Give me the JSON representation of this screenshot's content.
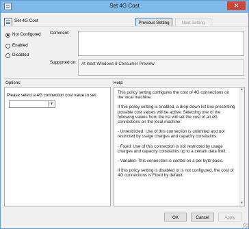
{
  "window": {
    "title": "Set 4G Cost",
    "close_glyph": "✕"
  },
  "header": {
    "policy_name": "Set 4G Cost",
    "prev_label": "Previous Setting",
    "next_label": "Next Setting"
  },
  "state": {
    "options": [
      {
        "label": "Not Configured",
        "selected": true
      },
      {
        "label": "Enabled",
        "selected": false
      },
      {
        "label": "Disabled",
        "selected": false
      }
    ]
  },
  "comment": {
    "label": "Comment:",
    "value": ""
  },
  "supported": {
    "label": "Supported on:",
    "value": "At least Windows 8 Consumer Preview"
  },
  "options_pane": {
    "title": "Options:",
    "prompt": "Please select a 4G connection cost value to set:",
    "selected_value": ""
  },
  "help_pane": {
    "title": "Help:",
    "paragraphs": [
      "This policy setting configures the cost of 4G connections on the local machine.",
      "If this policy setting is enabled, a drop-down list box presenting possible cost values will be active. Selecting one of the following values from the list will set the cost of all 4G connections on the local machine:",
      "- Unrestricted: Use of this connection is unlimited and not restricted by usage charges and capacity constraints.",
      "- Fixed: Use of this connection is not restricted by usage charges and capacity constraints up to a certain data limit.",
      "- Variable: This connection is costed on a per byte basis.",
      "If this policy setting is disabled or is not configured, the cost of 4G connections is Fixed by default."
    ]
  },
  "footer": {
    "ok_label": "OK",
    "cancel_label": "Cancel",
    "apply_label": "Apply"
  }
}
